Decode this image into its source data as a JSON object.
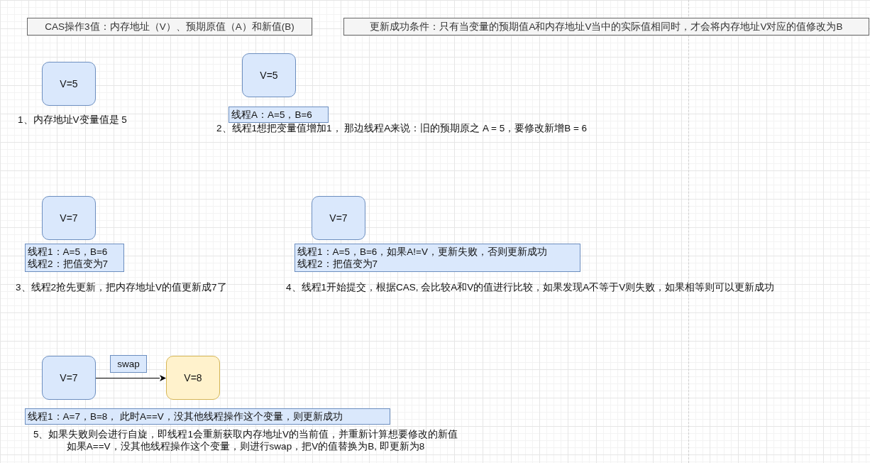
{
  "header_boxes": [
    "CAS操作3值：内存地址（V）、预期原值（A）和新值(B)",
    "更新成功条件：只有当变量的预期值A和内存地址V当中的实际值相同时，才会将内存地址V对应的值修改为B"
  ],
  "nodes": [
    {
      "text": "V=5",
      "kind": "memory"
    },
    {
      "text": "V=5",
      "kind": "memory"
    },
    {
      "text": "V=7",
      "kind": "memory"
    },
    {
      "text": "V=7",
      "kind": "memory"
    },
    {
      "text": "V=7",
      "kind": "memory"
    },
    {
      "text": "V=8",
      "kind": "updated"
    }
  ],
  "edge_label": "swap",
  "notes": [
    {
      "lines": [
        "线程A：A=5，B=6"
      ]
    },
    {
      "lines": [
        "线程1：A=5，B=6",
        "线程2：把值变为7"
      ]
    },
    {
      "lines": [
        "线程1：A=5，B=6，如果A!=V，更新失败，否则更新成功",
        "线程2：把值变为7"
      ]
    },
    {
      "lines": [
        "线程1：A=7，B=8，  此时A==V，没其他线程操作这个变量，则更新成功"
      ]
    }
  ],
  "captions": [
    {
      "lines": [
        "1、内存地址V变量值是 5"
      ]
    },
    {
      "lines": [
        "2、线程1想把变量值增加1， 那边线程A来说：旧的预期原之 A = 5，要修改新增B = 6"
      ]
    },
    {
      "lines": [
        "3、线程2抢先更新，把内存地址V的值更新成7了"
      ]
    },
    {
      "lines": [
        "4、线程1开始提交，根据CAS, 会比较A和V的值进行比较，如果发现A不等于V则失败，如果相等则可以更新成功"
      ]
    },
    {
      "lines": [
        "5、如果失败则会进行自旋，即线程1会重新获取内存地址V的当前值，并重新计算想要修改的新值",
        "如果A==V，没其他线程操作这个变量，则进行swap，把V的值替换为B, 即更新为8"
      ]
    }
  ]
}
